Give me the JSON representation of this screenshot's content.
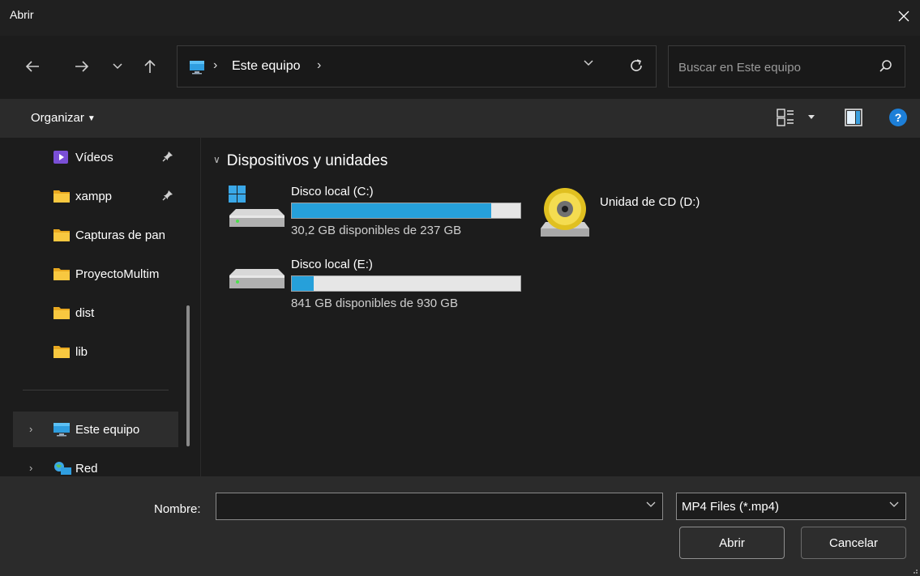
{
  "window": {
    "title": "Abrir"
  },
  "navigation": {
    "address_location": "Este equipo",
    "search_placeholder": "Buscar en Este equipo"
  },
  "commandbar": {
    "organize_label": "Organizar"
  },
  "sidebar": {
    "items": [
      {
        "label": "Vídeos",
        "icon": "videos-folder-icon",
        "pinned": true
      },
      {
        "label": "xampp",
        "icon": "folder-icon",
        "pinned": true
      },
      {
        "label": "Capturas de pan",
        "icon": "folder-icon",
        "pinned": false
      },
      {
        "label": "ProyectoMultim",
        "icon": "folder-icon",
        "pinned": false
      },
      {
        "label": "dist",
        "icon": "folder-icon",
        "pinned": false
      },
      {
        "label": "lib",
        "icon": "folder-icon",
        "pinned": false
      }
    ],
    "locations": [
      {
        "label": "Este equipo",
        "icon": "this-pc-icon",
        "selected": true
      },
      {
        "label": "Red",
        "icon": "network-icon",
        "selected": false
      }
    ]
  },
  "main": {
    "section_title": "Dispositivos y unidades",
    "drives": [
      {
        "name": "Disco local (C:)",
        "free_text": "30,2 GB disponibles de 237 GB",
        "used_fraction": 0.873,
        "icon": "windows-drive-icon"
      },
      {
        "name": "Disco local (E:)",
        "free_text": "841 GB disponibles de 930 GB",
        "used_fraction": 0.096,
        "icon": "drive-icon"
      }
    ],
    "cd_drive": {
      "name": "Unidad de CD (D:)",
      "icon": "cd-drive-icon"
    }
  },
  "footer": {
    "name_label": "Nombre:",
    "name_value": "",
    "filter_value": "MP4 Files (*.mp4)",
    "open_label": "Abrir",
    "cancel_label": "Cancelar"
  },
  "colors": {
    "accent": "#26a0da",
    "folder": "#f4c430",
    "background": "#1c1c1c",
    "panel": "#2b2b2b"
  }
}
